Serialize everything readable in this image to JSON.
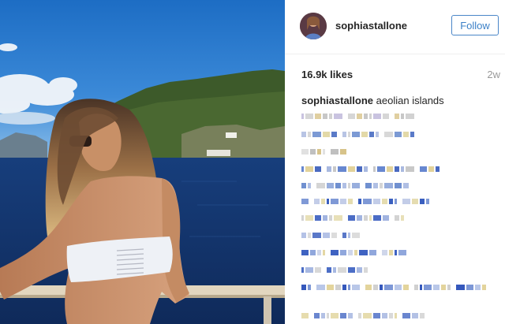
{
  "post": {
    "username": "sophiastallone",
    "follow_label": "Follow",
    "likes": "16.9k likes",
    "time_ago": "2w",
    "caption_user": "sophiastallone",
    "caption_text": "aeolian islands"
  }
}
